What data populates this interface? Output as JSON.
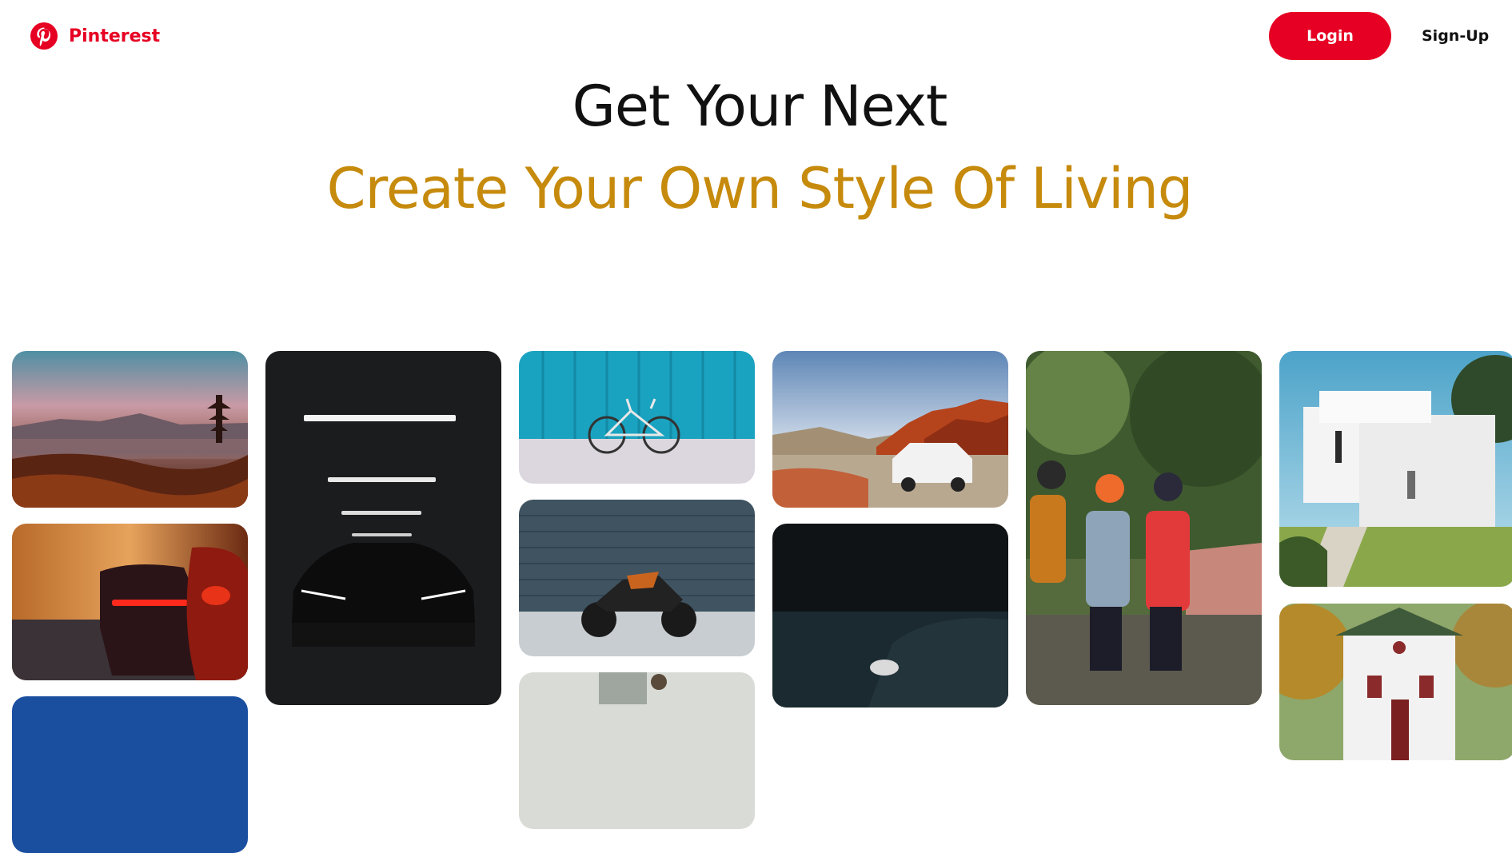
{
  "header": {
    "brand_name": "Pinterest",
    "logo_icon": "pinterest-logo-icon",
    "login_label": "Login",
    "signup_label": "Sign-Up"
  },
  "hero": {
    "title": "Get Your Next",
    "subtitle": "Create Your Own Style Of Living"
  },
  "colors": {
    "brand_red": "#e60023",
    "subtitle_gold": "#c68a0c",
    "text_dark": "#111111"
  },
  "pins": [
    {
      "name": "pin-pagoda-sunset"
    },
    {
      "name": "pin-red-car-taillights"
    },
    {
      "name": "pin-blue-night-partial"
    },
    {
      "name": "pin-dark-car-garage"
    },
    {
      "name": "pin-bicycle-blue-wall"
    },
    {
      "name": "pin-motorcycle-tile-wall"
    },
    {
      "name": "pin-interior-partial"
    },
    {
      "name": "pin-white-suv-desert"
    },
    {
      "name": "pin-dark-car-partial"
    },
    {
      "name": "pin-cyclists-group"
    },
    {
      "name": "pin-white-modern-house"
    },
    {
      "name": "pin-cottage-house"
    }
  ]
}
